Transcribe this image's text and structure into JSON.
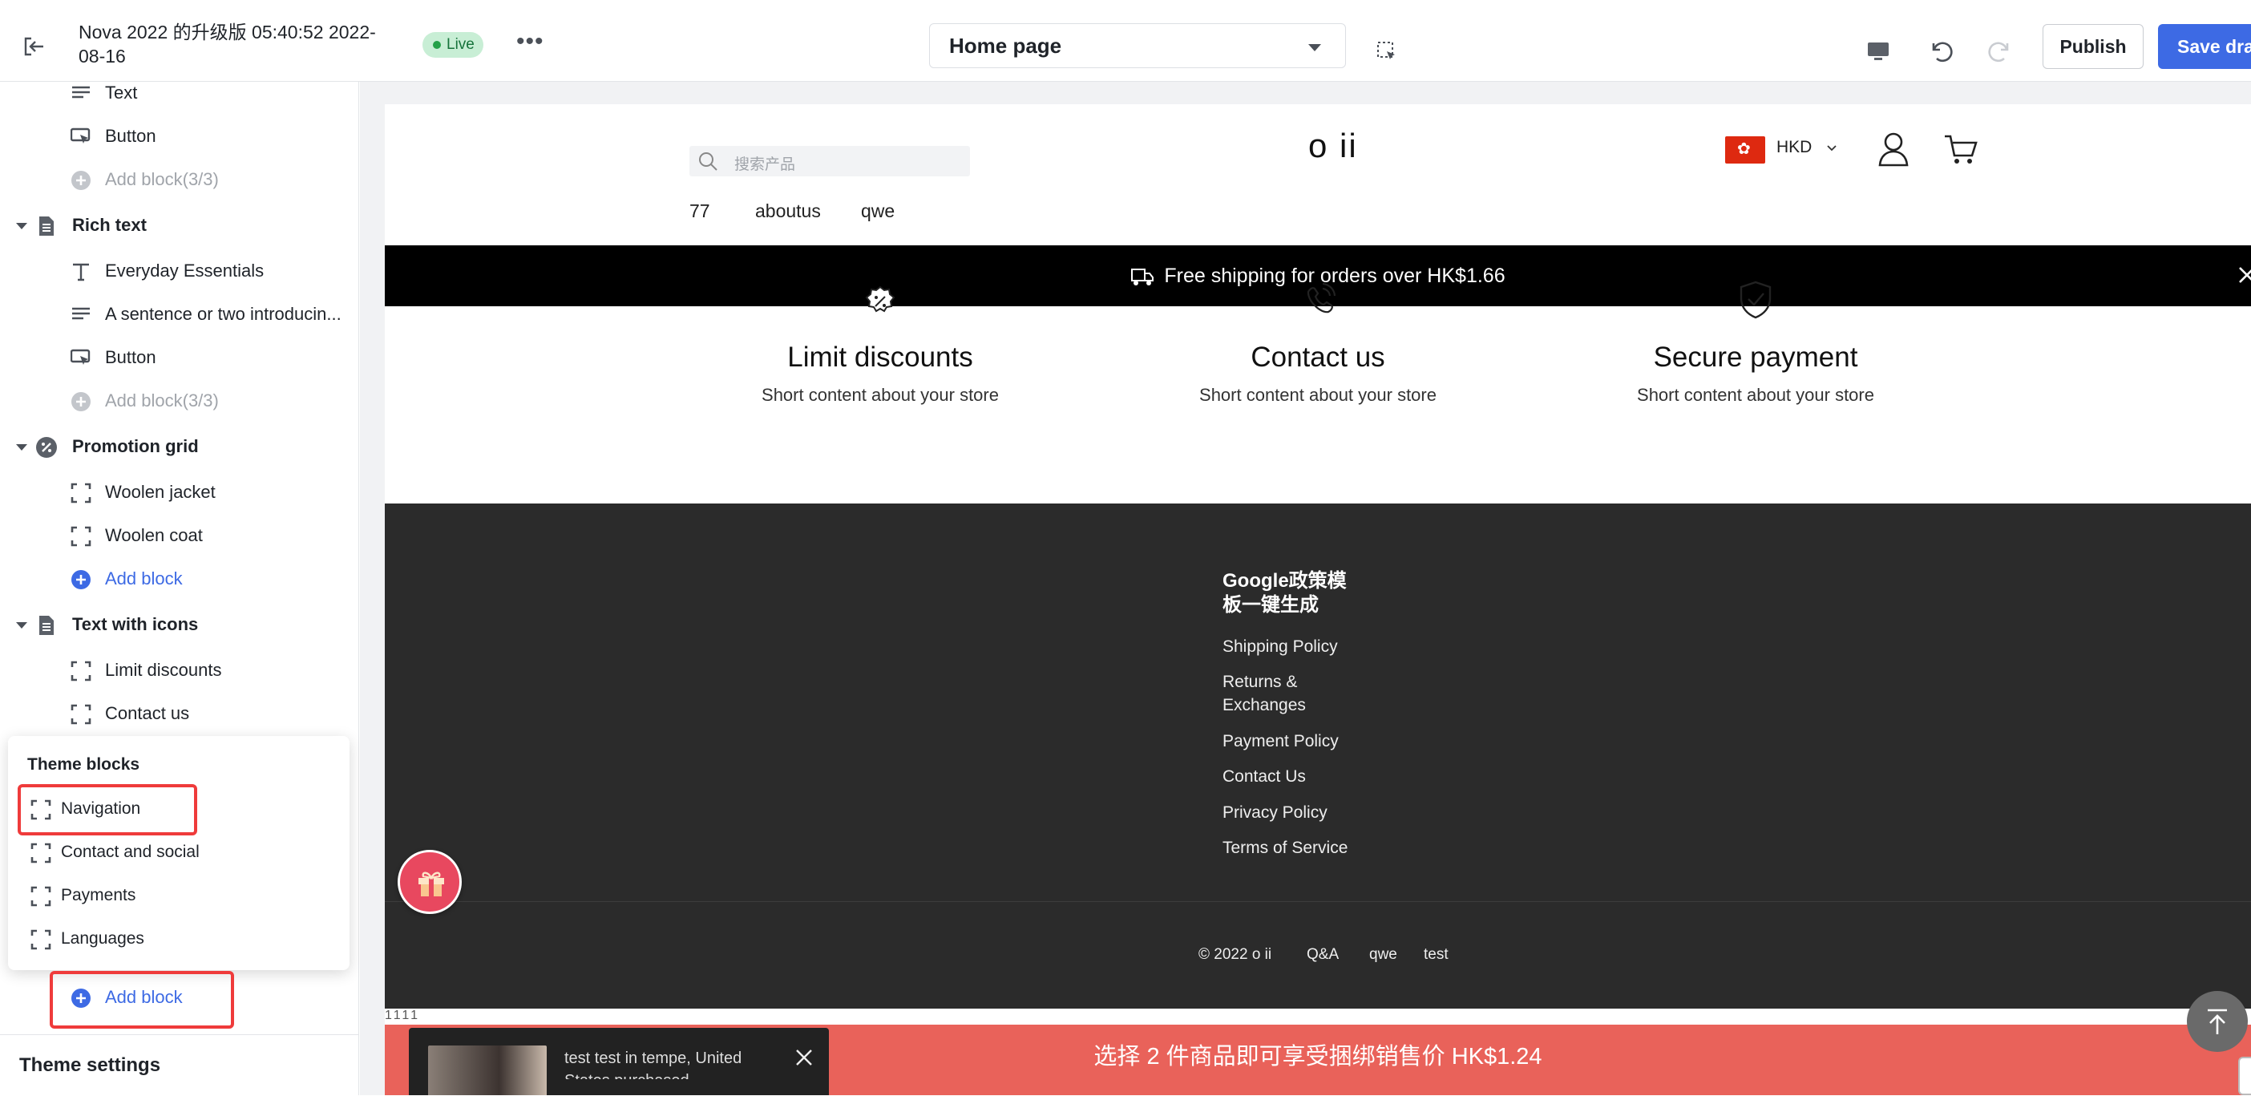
{
  "topbar": {
    "title": "Nova 2022 的升级版 05:40:52 2022-08-16",
    "live_label": "Live",
    "more_label": "•••",
    "page_select": "Home page",
    "publish_label": "Publish",
    "save_label": "Save draft"
  },
  "sidebar": {
    "rows": [
      {
        "label": "Text"
      },
      {
        "label": "Button"
      },
      {
        "label": "Add block(3/3)"
      },
      {
        "label": "Rich text"
      },
      {
        "label": "Everyday Essentials"
      },
      {
        "label": "A sentence or two introducin..."
      },
      {
        "label": "Button"
      },
      {
        "label": "Add block(3/3)"
      },
      {
        "label": "Promotion grid"
      },
      {
        "label": "Woolen jacket"
      },
      {
        "label": "Woolen coat"
      },
      {
        "label": "Add block"
      },
      {
        "label": "Text with icons"
      },
      {
        "label": "Limit discounts"
      },
      {
        "label": "Contact us"
      }
    ],
    "popover": {
      "title": "Theme blocks",
      "items": [
        "Navigation",
        "Contact and social",
        "Payments",
        "Languages"
      ]
    },
    "add_block": "Add block",
    "theme_settings": "Theme settings"
  },
  "preview": {
    "search_placeholder": "搜索产品",
    "logo": "o ii",
    "currency": "HKD",
    "nav": [
      "77",
      "aboutus",
      "qwe"
    ],
    "banner": "Free shipping for orders over HK$1.66",
    "features": [
      {
        "title": "Limit discounts",
        "desc": "Short content about your store"
      },
      {
        "title": "Contact us",
        "desc": "Short content about your store"
      },
      {
        "title": "Secure payment",
        "desc": "Short content about your store"
      }
    ],
    "footer": {
      "heading": "Google政策模板一键生成",
      "links": [
        "Shipping Policy",
        "Returns & Exchanges",
        "Payment Policy",
        "Contact Us",
        "Privacy Policy",
        "Terms of Service"
      ],
      "copyright": "© 2022 o ii",
      "bottom_links": [
        "Q&A",
        "qwe",
        "test"
      ]
    },
    "stray_text": "1111",
    "promo": "选择 2 件商品即可享受捆绑销售价 HK$1.24",
    "popup_text": "test test in tempe, United States purchased"
  },
  "colors": {
    "accent": "#3d6ae4",
    "live_bg": "#c8eed5",
    "footer_bg": "#2b2b2b",
    "promo_bg": "#e9625a",
    "highlight": "#ef3b3b"
  }
}
